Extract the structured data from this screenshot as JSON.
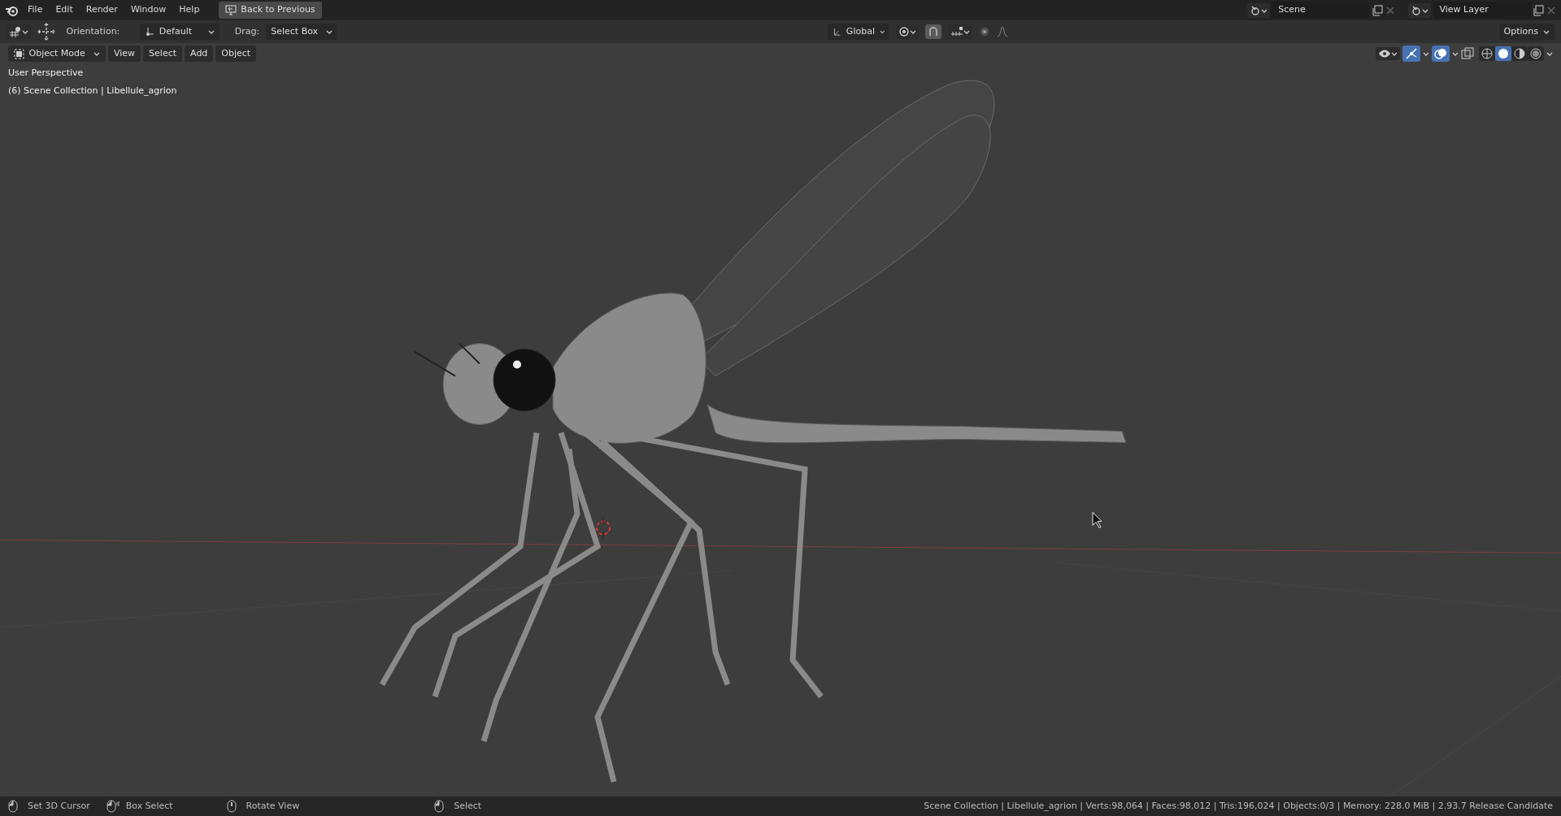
{
  "menu": [
    "File",
    "Edit",
    "Render",
    "Window",
    "Help"
  ],
  "back_button": "Back to Previous",
  "scene": {
    "label": "Scene"
  },
  "view_layer": {
    "label": "View Layer"
  },
  "tool_header": {
    "orientation_label": "Orientation:",
    "orientation": "Default",
    "drag_label": "Drag:",
    "drag": "Select Box",
    "transform_orientation": "Global",
    "snap_on": true,
    "options": "Options"
  },
  "viewport_header": {
    "mode": "Object Mode",
    "menus": [
      "View",
      "Select",
      "Add",
      "Object"
    ],
    "gizmo_on": true,
    "overlay_on": true,
    "shading": [
      {
        "kind": "wireframe",
        "selected": false
      },
      {
        "kind": "solid",
        "selected": true
      },
      {
        "kind": "material",
        "selected": false
      },
      {
        "kind": "rendered",
        "selected": false
      }
    ]
  },
  "viewport": {
    "view_name": "User Perspective",
    "collection": "(6) Scene Collection | Libellule_agrion"
  },
  "status_bar": {
    "hints": [
      {
        "kind": "left",
        "label": "Set 3D Cursor"
      },
      {
        "kind": "box",
        "label": "Box Select"
      },
      {
        "kind": "middle",
        "label": "Rotate View"
      },
      {
        "kind": "left",
        "label": "Select"
      }
    ],
    "stats": "Scene Collection | Libellule_agrion | Verts:98,064 | Faces:98,012 | Tris:196,024 | Objects:0/3 | Memory: 228.0 MiB | 2.93.7 Release Candidate"
  }
}
